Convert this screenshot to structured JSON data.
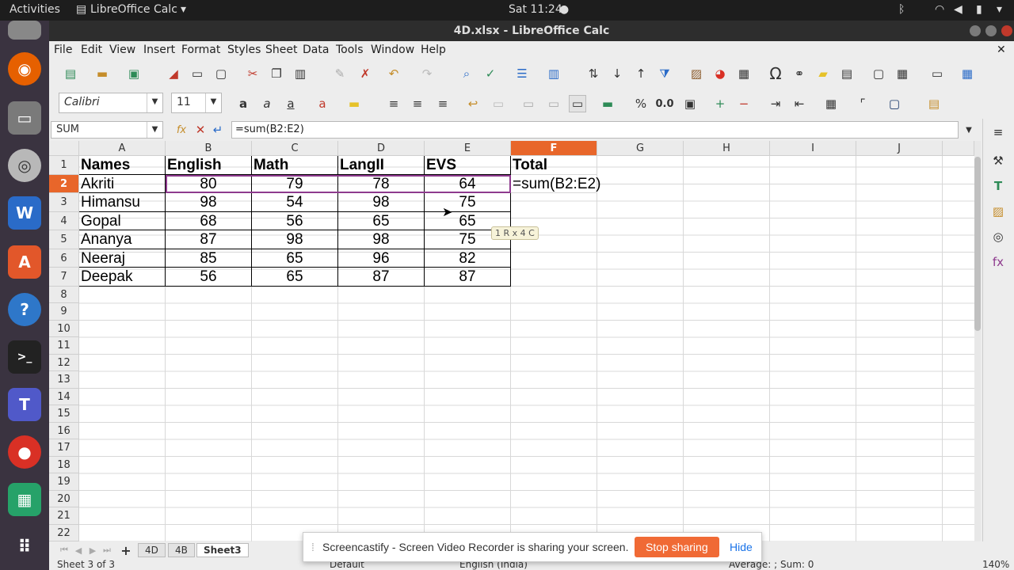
{
  "system": {
    "activities": "Activities",
    "app_menu": "LibreOffice Calc",
    "clock": "Sat 11:24"
  },
  "window": {
    "title": "4D.xlsx - LibreOffice Calc"
  },
  "menu": [
    "File",
    "Edit",
    "View",
    "Insert",
    "Format",
    "Styles",
    "Sheet",
    "Data",
    "Tools",
    "Window",
    "Help"
  ],
  "format_bar": {
    "font_name": "Calibri",
    "font_size": "11"
  },
  "formula_bar": {
    "name_box": "SUM",
    "formula": "=sum(B2:E2)"
  },
  "columns": [
    "A",
    "B",
    "C",
    "D",
    "E",
    "F",
    "G",
    "H",
    "I",
    "J"
  ],
  "rows": [
    "1",
    "2",
    "3",
    "4",
    "5",
    "6",
    "7",
    "8",
    "9",
    "10",
    "11",
    "12",
    "13",
    "14",
    "15",
    "16",
    "17",
    "18",
    "19",
    "20",
    "21",
    "22"
  ],
  "table": {
    "headers": [
      "Names",
      "English",
      "Math",
      "LangII",
      "EVS",
      "Total"
    ],
    "data": [
      [
        "Akriti",
        "80",
        "79",
        "78",
        "64"
      ],
      [
        "Himansu",
        "98",
        "54",
        "98",
        "75"
      ],
      [
        "Gopal",
        "68",
        "56",
        "65",
        "65"
      ],
      [
        "Ananya",
        "87",
        "98",
        "98",
        "75"
      ],
      [
        "Neeraj",
        "85",
        "65",
        "96",
        "82"
      ],
      [
        "Deepak",
        "56",
        "65",
        "87",
        "87"
      ]
    ],
    "editing_cell": "=sum(B2:E2)"
  },
  "tooltip": "1 R x 4 C",
  "sheets": [
    "4D",
    "4B",
    "Sheet3"
  ],
  "status": {
    "sheet_info": "Sheet 3 of 3",
    "page_style": "Default",
    "language": "English (India)",
    "summary": "Average: ; Sum: 0",
    "zoom": "140%"
  },
  "screencastify": {
    "message": "Screencastify - Screen Video Recorder is sharing your screen.",
    "stop_label": "Stop sharing",
    "hide_label": "Hide"
  },
  "colors": {
    "highlight_col": "#e8662a",
    "stop_button": "#f06a35",
    "hide_link": "#1a73e8",
    "range_border": "#8e3a8e"
  }
}
